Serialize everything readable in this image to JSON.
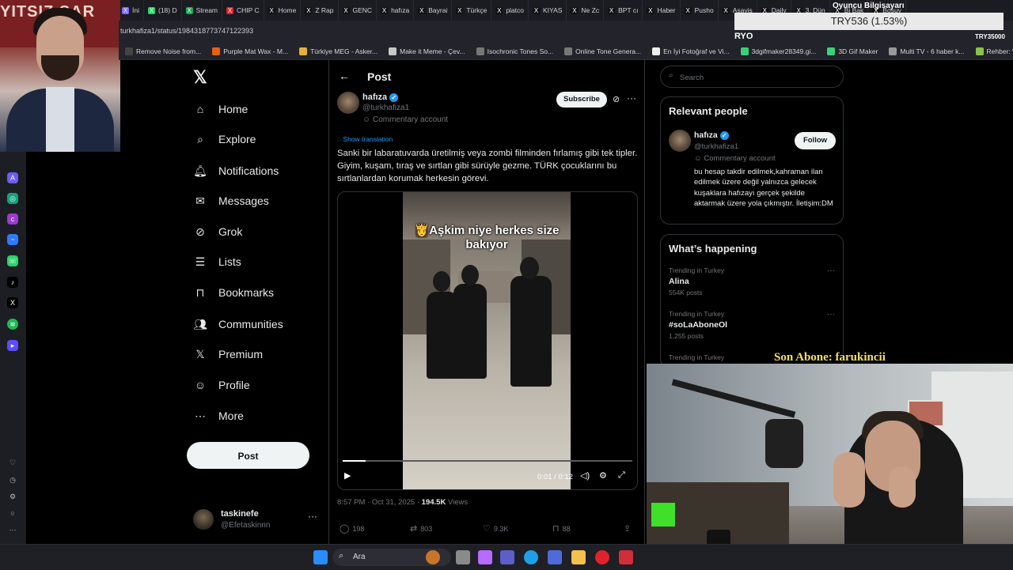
{
  "browser": {
    "tabs": [
      {
        "label": "İni",
        "color": "#7a6cff"
      },
      {
        "label": "(18) D",
        "color": "#25d366"
      },
      {
        "label": "Stream",
        "color": "#18a957"
      },
      {
        "label": "CHIP C",
        "color": "#e0232b"
      },
      {
        "label": "Home",
        "color": "#111111"
      },
      {
        "label": "Z Rap",
        "color": "#111111"
      },
      {
        "label": "GENC",
        "color": "#111111"
      },
      {
        "label": "hafıza",
        "color": "#111111"
      },
      {
        "label": "Bayrai",
        "color": "#111111"
      },
      {
        "label": "Türkçe",
        "color": "#111111"
      },
      {
        "label": "platco",
        "color": "#111111"
      },
      {
        "label": "KIYAS",
        "color": "#111111"
      },
      {
        "label": "Ne Zc",
        "color": "#111111"
      },
      {
        "label": "BPT cı",
        "color": "#111111"
      },
      {
        "label": "Haber",
        "color": "#111111"
      },
      {
        "label": "Pusho",
        "color": "#111111"
      },
      {
        "label": "Asayiş",
        "color": "#111111"
      },
      {
        "label": "Daily",
        "color": "#111111"
      },
      {
        "label": "3. Dün",
        "color": "#111111"
      },
      {
        "label": "Bi Bak",
        "color": "#111111"
      },
      {
        "label": "Boşuy",
        "color": "#111111"
      }
    ],
    "url": "turkhafiza1/status/1984318773747122393",
    "bookmarks": [
      {
        "label": "Remove Noise from...",
        "color": "#444444"
      },
      {
        "label": "Purple Mat Wax - M...",
        "color": "#e8600c"
      },
      {
        "label": "Türkiye MEG - Asker...",
        "color": "#e0b23a"
      },
      {
        "label": "Make it Meme - Çev...",
        "color": "#c7c7c7"
      },
      {
        "label": "Isochronic Tones So...",
        "color": "#777777"
      },
      {
        "label": "Online Tone Genera...",
        "color": "#777777"
      },
      {
        "label": "En İyi Fotoğraf ve Vi...",
        "color": "#eeeeee"
      },
      {
        "label": "3dgifmaker28349.gi...",
        "color": "#3ad07a"
      },
      {
        "label": "3D Gif Maker",
        "color": "#3ad07a"
      },
      {
        "label": "Multi TV - 6 haber k...",
        "color": "#999999"
      },
      {
        "label": "Rehber: Windows 1...",
        "color": "#8bc34a"
      }
    ]
  },
  "overlay": {
    "ticker": "TRY536 (1.53%)",
    "oyuncu": "Oyuncu Bilgisayarı",
    "ryo": "RYO",
    "try35": "TRY35000",
    "son_abone": "Son Abone: farukincii",
    "webcam_top_banner": "YITSIZ SAR"
  },
  "nav": {
    "items": [
      {
        "label": "Home",
        "icon": "home-icon"
      },
      {
        "label": "Explore",
        "icon": "search-icon"
      },
      {
        "label": "Notifications",
        "icon": "bell-icon"
      },
      {
        "label": "Messages",
        "icon": "envelope-icon"
      },
      {
        "label": "Grok",
        "icon": "grok-icon"
      },
      {
        "label": "Lists",
        "icon": "list-icon"
      },
      {
        "label": "Bookmarks",
        "icon": "bookmark-icon"
      },
      {
        "label": "Communities",
        "icon": "people-icon"
      },
      {
        "label": "Premium",
        "icon": "x-icon"
      },
      {
        "label": "Profile",
        "icon": "person-icon"
      },
      {
        "label": "More",
        "icon": "more-circle-icon"
      }
    ],
    "post_button": "Post",
    "account": {
      "name": "taskinefe",
      "handle": "@Efetaskinnn"
    }
  },
  "post": {
    "header_title": "Post",
    "author_name": "hafıza",
    "author_handle": "@turkhafiza1",
    "commentary_label": "Commentary account",
    "subscribe_label": "Subscribe",
    "show_translation": "Show translation",
    "text": "Sanki bir labaratuvarda üretilmiş veya zombi filminden fırlamış gibi tek tipler. Giyim, kuşam, tıraş ve sırtlan gibi sürüyle gezme. TÜRK çocuklarını bu sırtlanlardan korumak herkesin görevi.",
    "video": {
      "caption": "Aşkim niye herkes size bakıyor",
      "timecode": "0:01 / 0:12",
      "progress": 0.08
    },
    "timestamp": "8:57 PM · Oct 31, 2025 ·",
    "views_count": "194.5K",
    "views_label": "Views",
    "replies": "198",
    "reposts": "803",
    "likes": "9.3K",
    "bookmarks": "88"
  },
  "right": {
    "search_placeholder": "Search",
    "relevant_title": "Relevant people",
    "person": {
      "name": "hafıza",
      "handle": "@turkhafiza1",
      "commentary": "Commentary account",
      "follow_label": "Follow",
      "bio": "bu hesap takdir edilmek,kahraman ilan edilmek üzere değil yalnızca gelecek kuşaklara hafızayı gerçek şekilde aktarmak üzere yola çıkmıştır. İletişim:DM"
    },
    "happening_title": "What’s happening",
    "trends": [
      {
        "category": "Trending in Turkey",
        "name": "Alina",
        "count": "554K posts"
      },
      {
        "category": "Trending in Turkey",
        "name": "#soLaAboneOl",
        "count": "1,255 posts"
      },
      {
        "category": "Trending in Turkey",
        "name": "",
        "count": ""
      }
    ]
  },
  "taskbar": {
    "search_label": "Ara"
  }
}
